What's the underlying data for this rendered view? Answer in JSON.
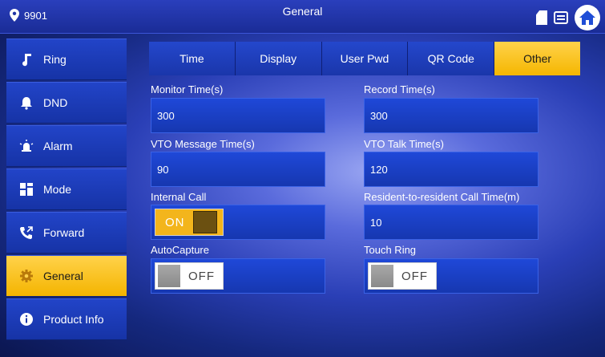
{
  "topbar": {
    "location": "9901",
    "title": "General"
  },
  "sidebar": {
    "items": [
      {
        "label": "Ring",
        "icon": "music-note-icon",
        "active": false
      },
      {
        "label": "DND",
        "icon": "bell-icon",
        "active": false
      },
      {
        "label": "Alarm",
        "icon": "alarm-siren-icon",
        "active": false
      },
      {
        "label": "Mode",
        "icon": "grid-mode-icon",
        "active": false
      },
      {
        "label": "Forward",
        "icon": "call-forward-icon",
        "active": false
      },
      {
        "label": "General",
        "icon": "gear-icon",
        "active": true
      },
      {
        "label": "Product Info",
        "icon": "info-icon",
        "active": false
      }
    ]
  },
  "tabs": [
    {
      "label": "Time",
      "active": false
    },
    {
      "label": "Display",
      "active": false
    },
    {
      "label": "User Pwd",
      "active": false
    },
    {
      "label": "QR Code",
      "active": false
    },
    {
      "label": "Other",
      "active": true
    }
  ],
  "settings": {
    "monitor_time": {
      "label": "Monitor Time(s)",
      "value": "300"
    },
    "record_time": {
      "label": "Record Time(s)",
      "value": "300"
    },
    "vto_message_time": {
      "label": "VTO Message Time(s)",
      "value": "90"
    },
    "vto_talk_time": {
      "label": "VTO Talk Time(s)",
      "value": "120"
    },
    "internal_call": {
      "label": "Internal Call",
      "state": "ON"
    },
    "resident_call_time": {
      "label": "Resident-to-resident Call Time(m)",
      "value": "10"
    },
    "auto_capture": {
      "label": "AutoCapture",
      "state": "OFF"
    },
    "touch_ring": {
      "label": "Touch Ring",
      "state": "OFF"
    }
  },
  "colors": {
    "accent": "#f4b400",
    "panel": "#1f48d8",
    "background": "#15287e"
  }
}
